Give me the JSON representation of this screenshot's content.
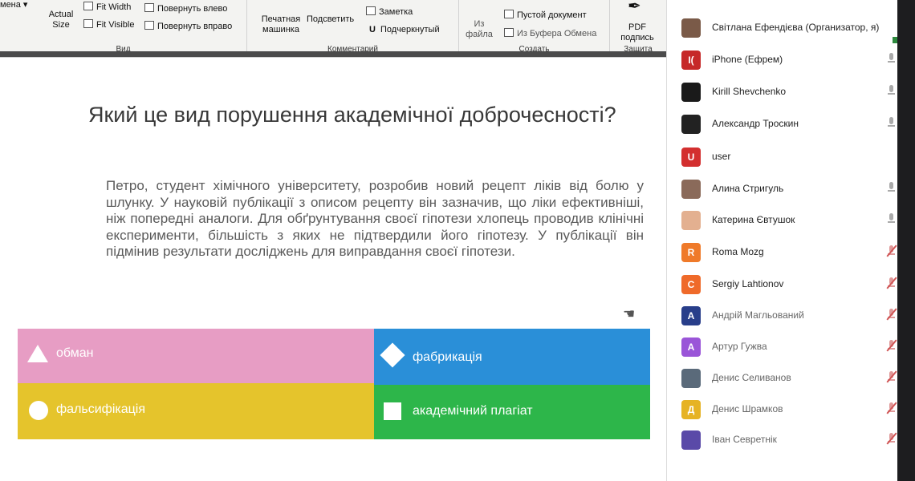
{
  "toolbar": {
    "truncated_label": "мена",
    "actual_size": "Actual Size",
    "fit_width": "Fit Width",
    "fit_visible": "Fit Visible",
    "rotate_left": "Повернуть влево",
    "rotate_right": "Повернуть вправо",
    "group_view": "Вид",
    "typewriter": "Печатная машинка",
    "highlight": "Подсветить",
    "note": "Заметка",
    "underline": "Подчеркнутый",
    "group_comment": "Комментарий",
    "from_file": "Из файла",
    "blank_doc": "Пустой документ",
    "from_clipboard": "Из Буфера Обмена",
    "group_create": "Создать",
    "pdf_sign": "PDF подпись",
    "group_protect": "Защита"
  },
  "slide": {
    "question": "Який це вид порушення академічної доброчесності?",
    "passage": "Петро, студент хімічного університету, розробив новий рецепт ліків від болю у шлунку. У науковій публікації з описом рецепту він зазначив, що ліки ефективніші, ніж попередні аналоги. Для обґрунтування своєї гіпотези хлопець проводив клінічні експерименти, більшість з яких не підтвердили його гіпотезу. У публікації він підмінив результати досліджень для виправдання своєї гіпотези.",
    "answers": [
      {
        "label": "обман",
        "shape": "triangle-icon",
        "color": "#e79dc4"
      },
      {
        "label": "фабрикація",
        "shape": "diamond-icon",
        "color": "#2a8fd8"
      },
      {
        "label": "фальсифікація",
        "shape": "circle-icon",
        "color": "#e5c42c"
      },
      {
        "label": "академічний плагіат",
        "shape": "square-icon",
        "color": "#2db64a"
      }
    ]
  },
  "participants": [
    {
      "name": "Світлана Ефендієва (Организатор, я)",
      "avatar_text": "",
      "avatar_color": "#7a5a48",
      "mic": "none"
    },
    {
      "name": "iPhone (Ефрем)",
      "avatar_text": "I(",
      "avatar_color": "#c62828",
      "mic": "on"
    },
    {
      "name": "Kirill Shevchenko",
      "avatar_text": "",
      "avatar_color": "#1a1a1a",
      "mic": "on"
    },
    {
      "name": "Александр Троскин",
      "avatar_text": "",
      "avatar_color": "#222222",
      "mic": "on"
    },
    {
      "name": "user",
      "avatar_text": "U",
      "avatar_color": "#d32f2f",
      "mic": "none"
    },
    {
      "name": "Алина Стригуль",
      "avatar_text": "",
      "avatar_color": "#8a6a5a",
      "mic": "on"
    },
    {
      "name": "Катерина Євтушок",
      "avatar_text": "",
      "avatar_color": "#e3b090",
      "mic": "on"
    },
    {
      "name": "Roma Mozg",
      "avatar_text": "R",
      "avatar_color": "#ef7a2a",
      "mic": "off"
    },
    {
      "name": "Sergiy Lahtionov",
      "avatar_text": "C",
      "avatar_color": "#ef6a2a",
      "mic": "off"
    },
    {
      "name": "Андрій Магльований",
      "avatar_text": "A",
      "avatar_color": "#283e8a",
      "mic": "off"
    },
    {
      "name": "Артур Гужва",
      "avatar_text": "A",
      "avatar_color": "#9a55d8",
      "mic": "off"
    },
    {
      "name": "Денис Селиванов",
      "avatar_text": "",
      "avatar_color": "#5a6a7a",
      "mic": "off"
    },
    {
      "name": "Денис Шрамков",
      "avatar_text": "Д",
      "avatar_color": "#e6b324",
      "mic": "off"
    },
    {
      "name": "Іван Севретнік",
      "avatar_text": "",
      "avatar_color": "#5a4aa8",
      "mic": "off"
    }
  ]
}
